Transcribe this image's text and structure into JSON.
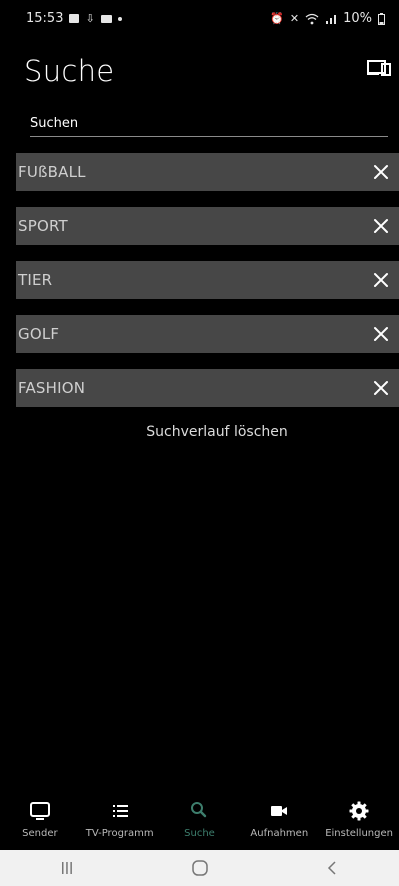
{
  "status_bar": {
    "time": "15:53",
    "battery": "10%"
  },
  "header": {
    "title": "Suche",
    "cast_icon": "cast-screen-icon"
  },
  "search": {
    "placeholder": "Suchen",
    "value": ""
  },
  "history": {
    "items": [
      {
        "label": "FUßBALL"
      },
      {
        "label": "SPORT"
      },
      {
        "label": "TIER"
      },
      {
        "label": "GOLF"
      },
      {
        "label": "FASHION"
      }
    ],
    "remove_icon": "close-icon",
    "clear_label": "Suchverlauf löschen"
  },
  "bottom_nav": {
    "items": [
      {
        "label": "Sender",
        "icon": "tv-icon"
      },
      {
        "label": "TV-Programm",
        "icon": "list-icon"
      },
      {
        "label": "Suche",
        "icon": "search-icon"
      },
      {
        "label": "Aufnahmen",
        "icon": "video-camera-icon"
      },
      {
        "label": "Einstellungen",
        "icon": "gear-icon"
      }
    ],
    "active": "Suche"
  },
  "colors": {
    "background": "#000000",
    "item_background": "#474747",
    "accent": "#3d7e6d",
    "system_nav_background": "#f1f1f1"
  }
}
